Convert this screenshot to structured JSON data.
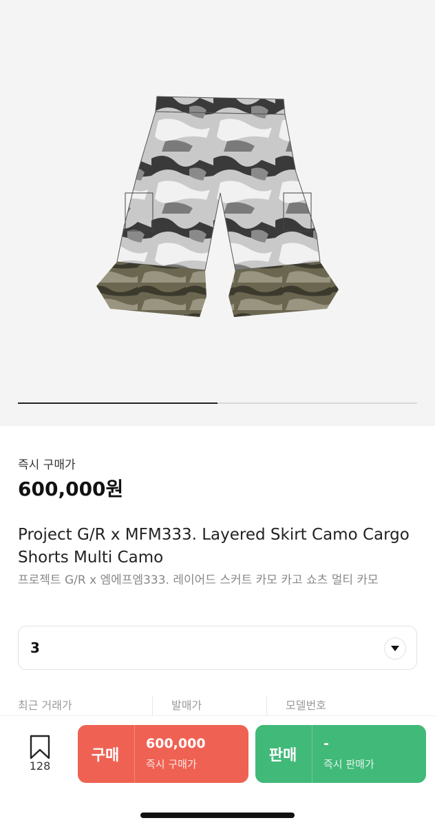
{
  "gallery": {
    "image_alt": "camo cargo shorts",
    "progress": 0.5
  },
  "price": {
    "label": "즉시 구매가",
    "value": "600,000원"
  },
  "product": {
    "title_en": "Project G/R x MFM333. Layered Skirt Camo Cargo Shorts Multi Camo",
    "title_ko": "프로젝트 G/R x 엠에프엠333. 레이어드 스커트 카모 카고 쇼츠 멀티 카모"
  },
  "size_select": {
    "value": "3",
    "icon": "chevron-down-icon"
  },
  "meta": {
    "recent_trade": "최근 거래가",
    "release_price": "발매가",
    "model_number": "모델번호"
  },
  "bottom": {
    "wish_icon": "bookmark-icon",
    "wish_count": "128",
    "buy": {
      "label": "구매",
      "price": "600,000",
      "sub": "즉시 구매가",
      "color": "#ef6253"
    },
    "sell": {
      "label": "판매",
      "price": "-",
      "sub": "즉시 판매가",
      "color": "#41b979"
    }
  }
}
